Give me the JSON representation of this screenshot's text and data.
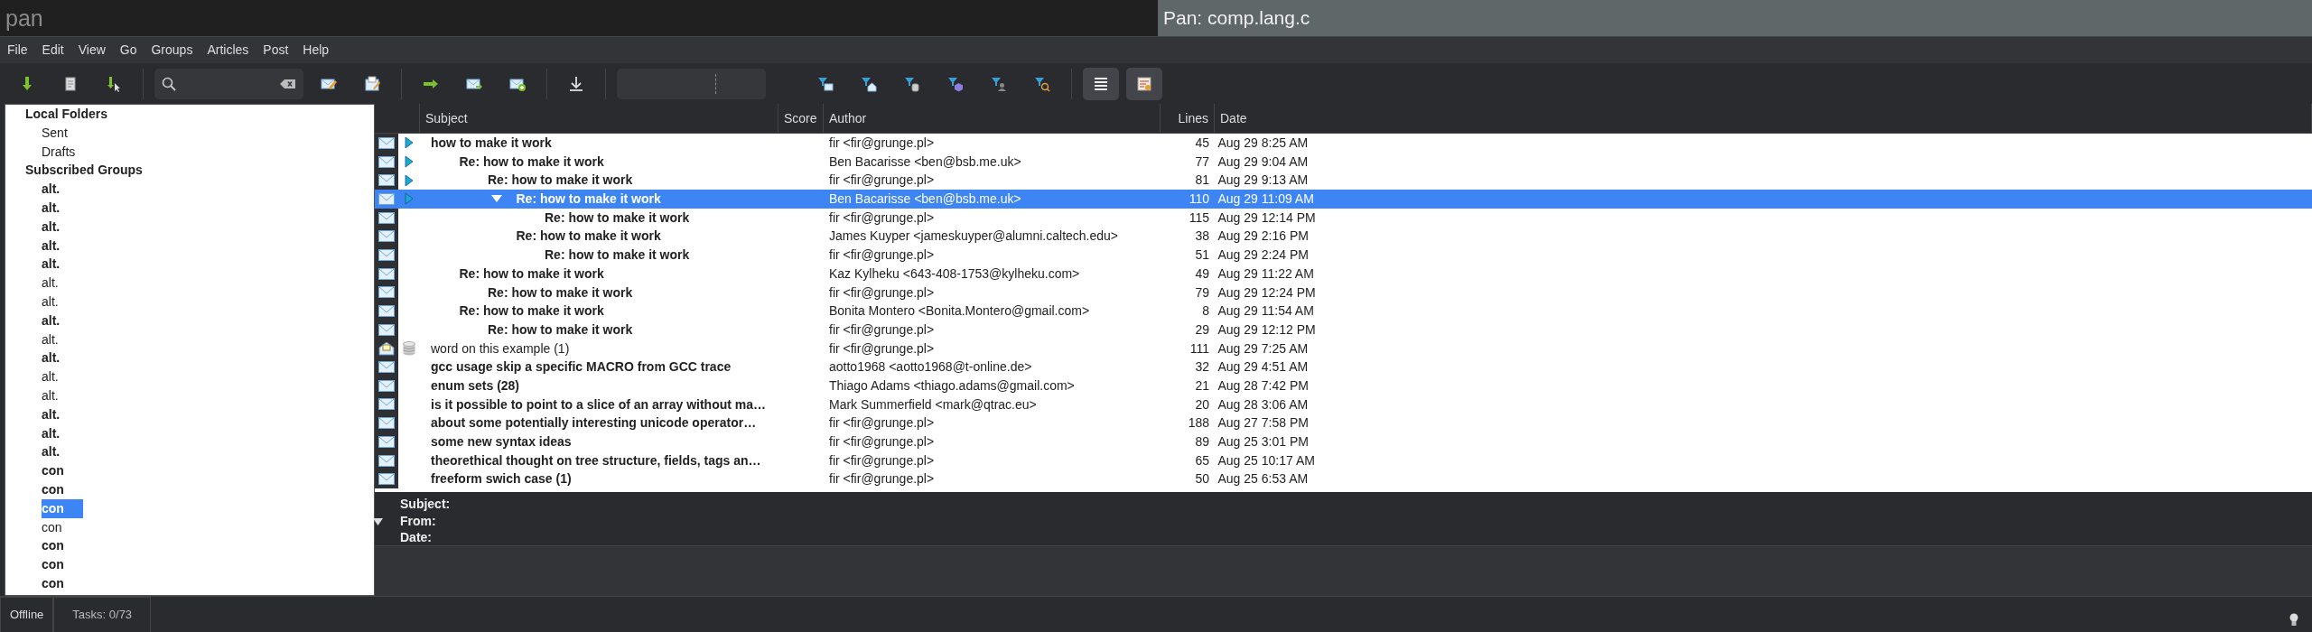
{
  "app_title": "pan",
  "window_title": "Pan: comp.lang.c",
  "menu": [
    "File",
    "Edit",
    "View",
    "Go",
    "Groups",
    "Articles",
    "Post",
    "Help"
  ],
  "folder_tree": [
    {
      "label": "Local Folders",
      "children": [
        {
          "label": "Sent"
        },
        {
          "label": "Drafts"
        }
      ]
    },
    {
      "label": "Subscribed Groups",
      "children": [
        {
          "label": "alt.",
          "unread": true,
          "selected": false
        },
        {
          "label": "alt.",
          "unread": true,
          "selected": false
        },
        {
          "label": "alt.",
          "unread": true,
          "selected": false
        },
        {
          "label": "alt.",
          "unread": true,
          "selected": false
        },
        {
          "label": "alt.",
          "unread": true,
          "selected": false
        },
        {
          "label": "alt.",
          "unread": false,
          "selected": false
        },
        {
          "label": "alt.",
          "unread": false,
          "selected": false
        },
        {
          "label": "alt.",
          "unread": true,
          "selected": false
        },
        {
          "label": "alt.",
          "unread": false,
          "selected": false
        },
        {
          "label": "alt.",
          "unread": true,
          "selected": false
        },
        {
          "label": "alt.",
          "unread": false,
          "selected": false
        },
        {
          "label": "alt.",
          "unread": false,
          "selected": false
        },
        {
          "label": "alt.",
          "unread": true,
          "selected": false
        },
        {
          "label": "alt.",
          "unread": true,
          "selected": false
        },
        {
          "label": "alt.",
          "unread": true,
          "selected": false
        },
        {
          "label": "con",
          "unread": true,
          "selected": false
        },
        {
          "label": "con",
          "unread": true,
          "selected": false
        },
        {
          "label": "con",
          "unread": true,
          "selected": true
        },
        {
          "label": "con",
          "unread": false,
          "selected": false
        },
        {
          "label": "con",
          "unread": true,
          "selected": false
        },
        {
          "label": "con",
          "unread": true,
          "selected": false
        },
        {
          "label": "con",
          "unread": true,
          "selected": false
        }
      ]
    }
  ],
  "columns": [
    "Subject",
    "Score",
    "Author",
    "Lines",
    "Date"
  ],
  "threads": [
    {
      "subject": "how to make it work",
      "author": "fir <fir@grunge.pl>",
      "lines": "45",
      "date": "Aug 29 8:25 AM",
      "unread": true,
      "selected": false,
      "flagged": true,
      "cached": false,
      "kind": "envelope",
      "children": [
        {
          "subject": "Re: how to make it work",
          "author": "Ben Bacarisse <ben@bsb.me.uk>",
          "lines": "77",
          "date": "Aug 29 9:04 AM",
          "unread": true,
          "selected": false,
          "flagged": true,
          "cached": false,
          "kind": "envelope",
          "children": [
            {
              "subject": "Re: how to make it work",
              "author": "fir <fir@grunge.pl>",
              "lines": "81",
              "date": "Aug 29 9:13 AM",
              "unread": true,
              "selected": false,
              "flagged": true,
              "cached": false,
              "kind": "envelope",
              "children": [
                {
                  "subject": "Re: how to make it work",
                  "author": "Ben Bacarisse <ben@bsb.me.uk>",
                  "lines": "110",
                  "date": "Aug 29 11:09 AM",
                  "unread": true,
                  "selected": true,
                  "flagged": true,
                  "cached": false,
                  "kind": "envelope",
                  "expanded": true,
                  "children": [
                    {
                      "subject": "Re: how to make it work",
                      "author": "fir <fir@grunge.pl>",
                      "lines": "115",
                      "date": "Aug 29 12:14 PM",
                      "unread": true,
                      "selected": false,
                      "flagged": false,
                      "cached": false,
                      "kind": "envelope"
                    }
                  ]
                },
                {
                  "subject": "Re: how to make it work",
                  "author": "James Kuyper <jameskuyper@alumni.caltech.edu>",
                  "lines": "38",
                  "date": "Aug 29 2:16 PM",
                  "unread": true,
                  "selected": false,
                  "flagged": false,
                  "cached": false,
                  "kind": "envelope",
                  "children": [
                    {
                      "subject": "Re: how to make it work",
                      "author": "fir <fir@grunge.pl>",
                      "lines": "51",
                      "date": "Aug 29 2:24 PM",
                      "unread": true,
                      "selected": false,
                      "flagged": false,
                      "cached": false,
                      "kind": "envelope"
                    }
                  ]
                }
              ]
            }
          ]
        },
        {
          "subject": "Re: how to make it work",
          "author": "Kaz Kylheku <643-408-1753@kylheku.com>",
          "lines": "49",
          "date": "Aug 29 11:22 AM",
          "unread": true,
          "selected": false,
          "flagged": false,
          "cached": false,
          "kind": "envelope",
          "children": [
            {
              "subject": "Re: how to make it work",
              "author": "fir <fir@grunge.pl>",
              "lines": "79",
              "date": "Aug 29 12:24 PM",
              "unread": true,
              "selected": false,
              "flagged": false,
              "cached": false,
              "kind": "envelope"
            }
          ]
        },
        {
          "subject": "Re: how to make it work",
          "author": "Bonita Montero <Bonita.Montero@gmail.com>",
          "lines": "8",
          "date": "Aug 29 11:54 AM",
          "unread": true,
          "selected": false,
          "flagged": false,
          "cached": false,
          "kind": "envelope",
          "children": [
            {
              "subject": "Re: how to make it work",
              "author": "fir <fir@grunge.pl>",
              "lines": "29",
              "date": "Aug 29 12:12 PM",
              "unread": true,
              "selected": false,
              "flagged": false,
              "cached": false,
              "kind": "envelope"
            }
          ]
        }
      ]
    },
    {
      "subject": "word on this example (1)",
      "author": "fir <fir@grunge.pl>",
      "lines": "111",
      "date": "Aug 29 7:25 AM",
      "unread": false,
      "selected": false,
      "flagged": false,
      "cached": true,
      "kind": "opened"
    },
    {
      "subject": "gcc usage skip a specific MACRO from GCC trace",
      "author": "aotto1968 <aotto1968@t-online.de>",
      "lines": "32",
      "date": "Aug 29 4:51 AM",
      "unread": true,
      "selected": false,
      "flagged": false,
      "cached": false,
      "kind": "envelope"
    },
    {
      "subject": "enum sets (28)",
      "author": "Thiago Adams <thiago.adams@gmail.com>",
      "lines": "21",
      "date": "Aug 28 7:42 PM",
      "unread": true,
      "selected": false,
      "flagged": false,
      "cached": false,
      "kind": "envelope"
    },
    {
      "subject": "is it possible to point to a slice of an array without ma…",
      "author": "Mark Summerfield <mark@qtrac.eu>",
      "lines": "20",
      "date": "Aug 28 3:06 AM",
      "unread": true,
      "selected": false,
      "flagged": false,
      "cached": false,
      "kind": "envelope"
    },
    {
      "subject": "about some potentially interesting unicode operator…",
      "author": "fir <fir@grunge.pl>",
      "lines": "188",
      "date": "Aug 27 7:58 PM",
      "unread": true,
      "selected": false,
      "flagged": false,
      "cached": false,
      "kind": "envelope"
    },
    {
      "subject": "some new syntax ideas",
      "author": "fir <fir@grunge.pl>",
      "lines": "89",
      "date": "Aug 25 3:01 PM",
      "unread": true,
      "selected": false,
      "flagged": false,
      "cached": false,
      "kind": "envelope"
    },
    {
      "subject": "theorethical thought on tree structure, fields, tags an…",
      "author": "fir <fir@grunge.pl>",
      "lines": "65",
      "date": "Aug 25 10:17 AM",
      "unread": true,
      "selected": false,
      "flagged": false,
      "cached": false,
      "kind": "envelope"
    },
    {
      "subject": "freeform swich case (1)",
      "author": "fir <fir@grunge.pl>",
      "lines": "50",
      "date": "Aug 25 6:53 AM",
      "unread": true,
      "selected": false,
      "flagged": false,
      "cached": false,
      "kind": "envelope"
    }
  ],
  "preview": {
    "expanded": true,
    "fields": [
      "Subject:",
      "From:",
      "Date:"
    ]
  },
  "status": [
    "Offline",
    "Tasks: 0/73"
  ]
}
